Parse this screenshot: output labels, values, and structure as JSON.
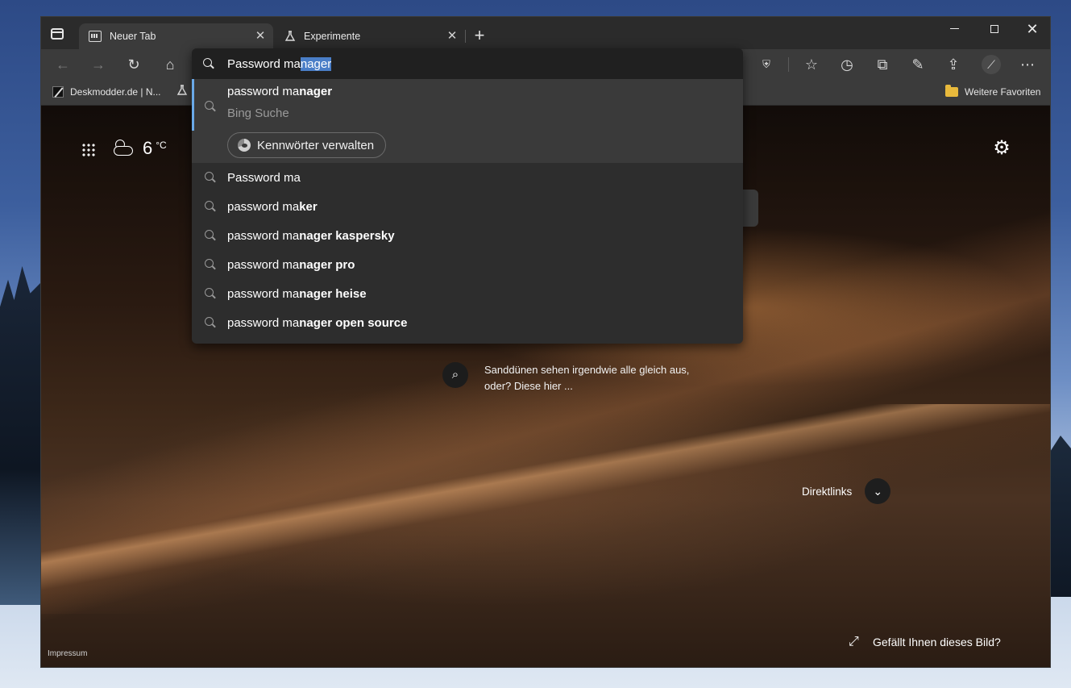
{
  "tabs": [
    {
      "label": "Neuer Tab",
      "active": true,
      "icon": "newtab-icon"
    },
    {
      "label": "Experimente",
      "active": false,
      "icon": "flask-icon"
    }
  ],
  "window_controls": {
    "minimize": "minimize-icon",
    "maximize": "maximize-icon",
    "close": "✕"
  },
  "address_bar": {
    "typed": "Password ma",
    "autocomplete": "nager"
  },
  "top_suggestion": {
    "title_plain": "password ma",
    "title_bold": "nager",
    "subtitle": "Bing Suche",
    "action_label": "Kennwörter verwalten"
  },
  "suggestions": [
    {
      "plain": "Password ma",
      "bold": ""
    },
    {
      "plain": "password ma",
      "bold": "ker"
    },
    {
      "plain": "password ma",
      "bold": "nager kaspersky"
    },
    {
      "plain": "password ma",
      "bold": "nager pro"
    },
    {
      "plain": "password ma",
      "bold": "nager heise"
    },
    {
      "plain": "password ma",
      "bold": "nager open source"
    }
  ],
  "favorites": {
    "item1": "Deskmodder.de | N...",
    "more": "Weitere Favoriten"
  },
  "weather": {
    "temp": "6",
    "unit": "°C"
  },
  "image_info": "Sanddünen sehen irgendwie alle gleich aus, oder? Diese hier ...",
  "direktlinks": "Direktlinks",
  "impressum": "Impressum",
  "like_image": "Gefällt Ihnen dieses Bild?",
  "colors": {
    "accent": "#6aa9e8",
    "selection": "#4a7ec7",
    "folder": "#e8b93c"
  }
}
